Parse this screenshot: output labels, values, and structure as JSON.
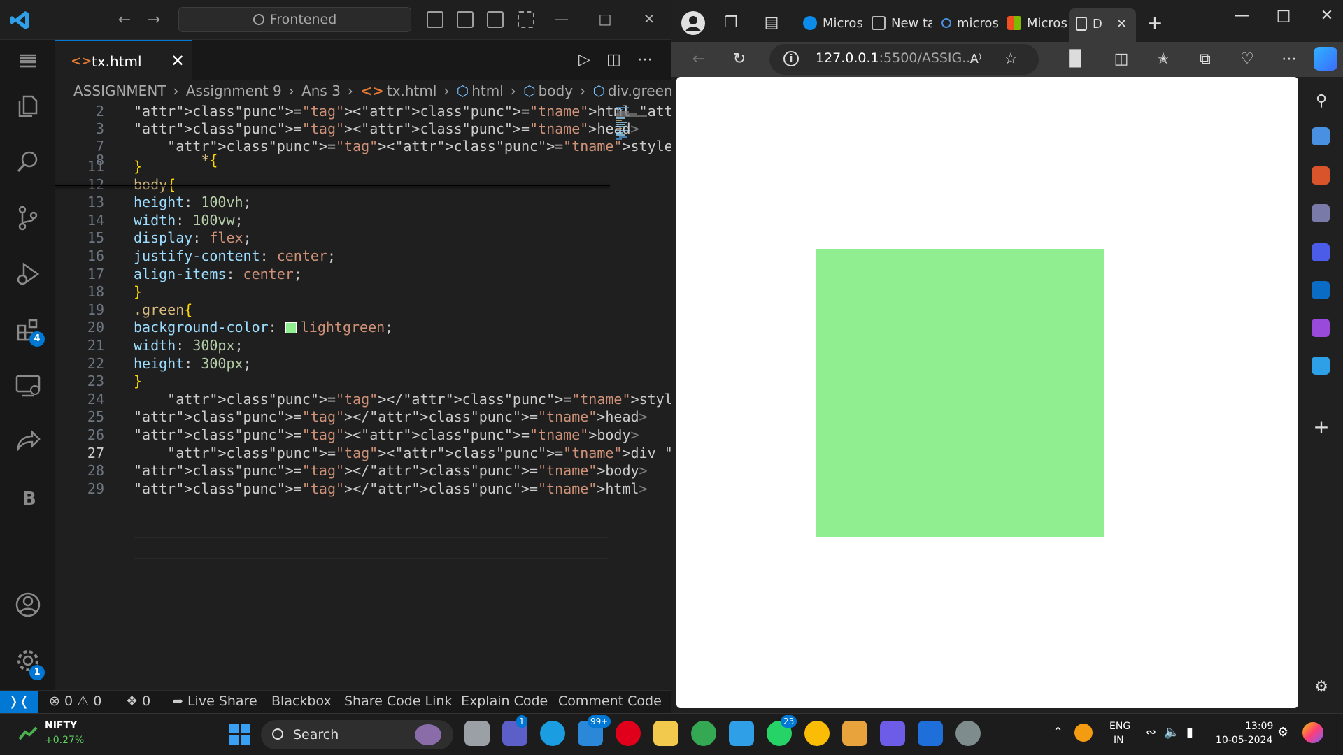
{
  "vscode": {
    "search_label": "Frontened",
    "tab": {
      "label": "tx.html",
      "icon": "<>"
    },
    "breadcrumb": [
      "ASSIGNMENT",
      "Assignment 9",
      "Ans 3",
      "tx.html",
      "html",
      "body",
      "div.green"
    ],
    "lines": [
      {
        "n": "2",
        "code": "<html lang=\"en\">"
      },
      {
        "n": "3",
        "code": "<head>"
      },
      {
        "n": "7",
        "code": "    <style>"
      },
      {
        "n": "8",
        "code": "        *{"
      },
      {
        "n": "11",
        "code": "}"
      },
      {
        "n": "12",
        "code": "body{"
      },
      {
        "n": "13",
        "code": "height: 100vh;"
      },
      {
        "n": "14",
        "code": "width: 100vw;"
      },
      {
        "n": "15",
        "code": "display: flex;"
      },
      {
        "n": "16",
        "code": "justify-content: center;"
      },
      {
        "n": "17",
        "code": "align-items: center;"
      },
      {
        "n": "18",
        "code": "}"
      },
      {
        "n": "19",
        "code": ".green{"
      },
      {
        "n": "20",
        "code": "background-color: lightgreen;"
      },
      {
        "n": "21",
        "code": "width: 300px;"
      },
      {
        "n": "22",
        "code": "height: 300px;"
      },
      {
        "n": "23",
        "code": "}"
      },
      {
        "n": "24",
        "code": "    </style>"
      },
      {
        "n": "25",
        "code": "</head>"
      },
      {
        "n": "26",
        "code": "<body>"
      },
      {
        "n": "27",
        "code": "    <div class=\"green\"></div>"
      },
      {
        "n": "28",
        "code": "</body>"
      },
      {
        "n": "29",
        "code": "</html>"
      }
    ],
    "activity_badges": {
      "extensions": "4",
      "settings": "1"
    },
    "status": {
      "errors": "0",
      "warnings": "0",
      "ports": "0",
      "live_share": "Live Share",
      "blackbox": "Blackbox",
      "share_code_link": "Share Code Link",
      "explain_code": "Explain Code",
      "comment_code": "Comment Code"
    }
  },
  "edge": {
    "tabs": [
      "Micros",
      "New ta",
      "micros",
      "Micros",
      "D"
    ],
    "url_host": "127.0.0.1",
    "url_rest": ":5500/ASSIG...",
    "read_aloud": "A⁾"
  },
  "taskbar": {
    "nifty_name": "NIFTY",
    "nifty_change": "+0.27%",
    "search_label": "Search",
    "badges": {
      "teams": "1",
      "mail": "99+",
      "whatsapp": "23"
    },
    "lang_top": "ENG",
    "lang_bottom": "IN",
    "time": "13:09",
    "date": "10-05-2024"
  },
  "colors": {
    "accent": "#0078d4",
    "green_box": "#90ee90"
  }
}
